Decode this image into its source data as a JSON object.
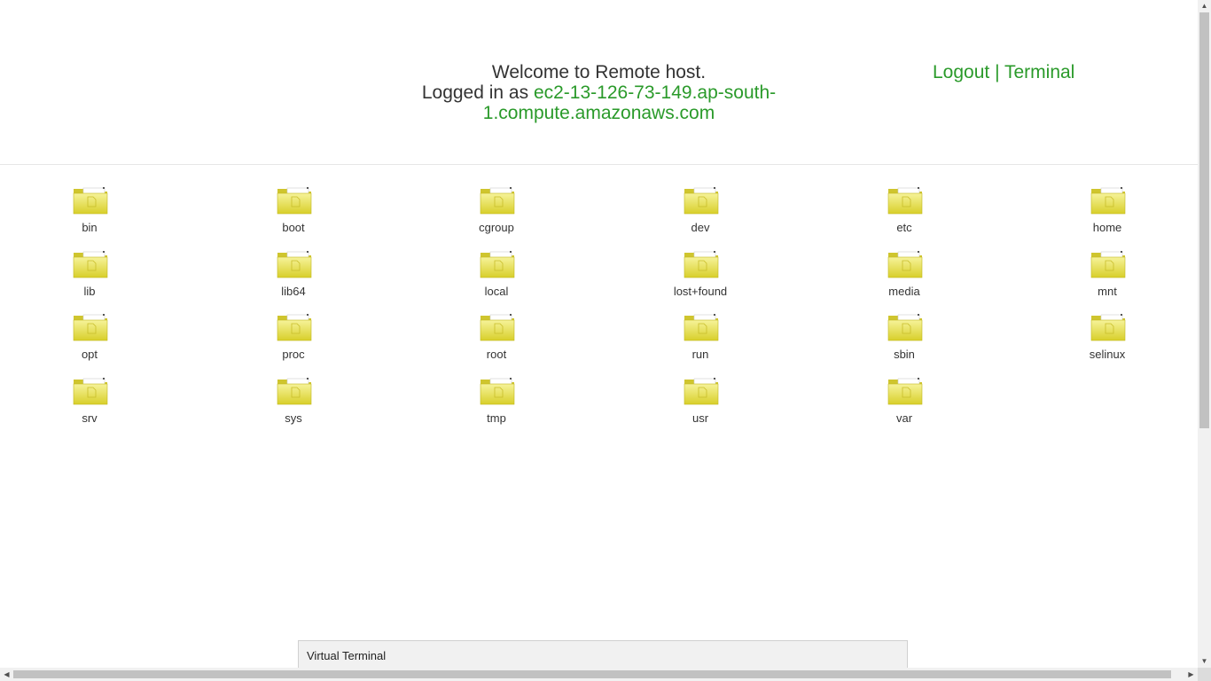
{
  "header": {
    "welcome_line": "Welcome to Remote host.",
    "logged_in_prefix": "Logged in as ",
    "hostname": "ec2-13-126-73-149.ap-south-1.compute.amazonaws.com",
    "logout_label": "Logout",
    "separator": " | ",
    "terminal_label": "Terminal"
  },
  "folders": [
    "bin",
    "boot",
    "cgroup",
    "dev",
    "etc",
    "home",
    "lib",
    "lib64",
    "local",
    "lost+found",
    "media",
    "mnt",
    "opt",
    "proc",
    "root",
    "run",
    "sbin",
    "selinux",
    "srv",
    "sys",
    "tmp",
    "usr",
    "var"
  ],
  "folder_icon": "folder-icon",
  "virtual_terminal": {
    "title": "Virtual Terminal"
  },
  "colors": {
    "link": "#2a9a2a",
    "folder_yellow": "#e6e04a"
  }
}
